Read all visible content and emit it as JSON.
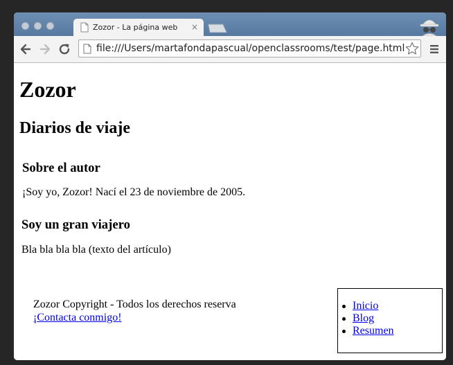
{
  "browser": {
    "tab_title": "Zozor - La página web",
    "tab_close": "×",
    "url": "file:///Users/martafondapascual/openclassrooms/test/page.html"
  },
  "page": {
    "site_title": "Zozor",
    "site_subtitle": "Diarios de viaje",
    "aside_heading": "Sobre el autor",
    "aside_text": "¡Soy yo, Zozor! Nací el 23 de noviembre de 2005.",
    "article_heading": "Soy un gran viajero",
    "article_text": "Bla bla bla bla (texto del artículo)",
    "footer_copyright": "Zozor Copyright - Todos los derechos reserva",
    "footer_contact": "¡Contacta conmigo!",
    "nav_links": [
      "Inicio",
      "Blog",
      "Resumen"
    ]
  },
  "colors": {
    "tabstrip": "#6384ab",
    "toolbar": "#f3f3f3",
    "link": "#0000ee",
    "page_background": "#ffffff"
  },
  "icons": [
    "page-icon",
    "close-icon",
    "back-arrow-icon",
    "forward-arrow-icon",
    "reload-icon",
    "star-icon",
    "menu-icon",
    "incognito-icon"
  ]
}
